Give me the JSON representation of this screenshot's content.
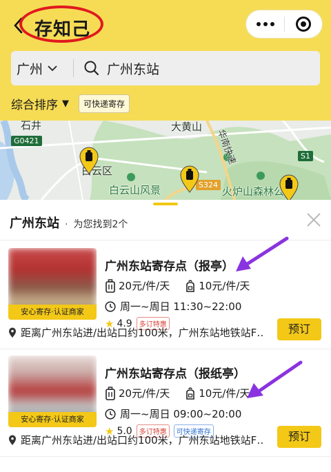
{
  "nav": {
    "title": "存知己",
    "back_icon": "chevron-left-icon",
    "more_icon": "more-dots-icon",
    "close_icon": "target-close-icon"
  },
  "search": {
    "city": "广州",
    "query": "广州东站",
    "icon": "search-icon"
  },
  "filters": {
    "sort_label": "综合排序",
    "sort_arrow": "▼",
    "chip": "可快递寄存"
  },
  "map": {
    "labels": [
      "石井",
      "大黄山",
      "白云区",
      "白云山风景",
      "火炉山森林公",
      "华南快速"
    ],
    "road_badges": [
      "G0421",
      "S324",
      "S1"
    ],
    "pin_icon": "luggage-pin-icon"
  },
  "results": {
    "location": "广州东站",
    "found_text": "为您找到2个",
    "close_icon": "close-x-icon",
    "items": [
      {
        "name": "广州东站寄存点（报亭）",
        "price_large": "20元/件/天",
        "price_small": "10元/件/天",
        "hours": "周一~周日 11:30~22:00",
        "rating": "4.9",
        "badges": [
          "多订特惠"
        ],
        "thumb_tag": "安心寄存·认证商家",
        "address": "距离广州东站进/出站口约100米，广州东站地铁站F…",
        "book": "预订"
      },
      {
        "name": "广州东站寄存点（报纸亭）",
        "price_large": "20元/件/天",
        "price_small": "10元/件/天",
        "hours": "周一~周日 09:00~20:00",
        "rating": "5.0",
        "badges": [
          "多订特惠",
          "可快递寄存"
        ],
        "thumb_tag": "安心寄存·认证商家",
        "address": "距离广州东站进/出站口约100米，广州东站地铁站F…",
        "book": "预订"
      }
    ]
  },
  "colors": {
    "brand_yellow": "#f3c817",
    "header_yellow": "#f6dc55",
    "annotation_red": "#e0191e",
    "annotation_purple": "#8a33e0"
  }
}
